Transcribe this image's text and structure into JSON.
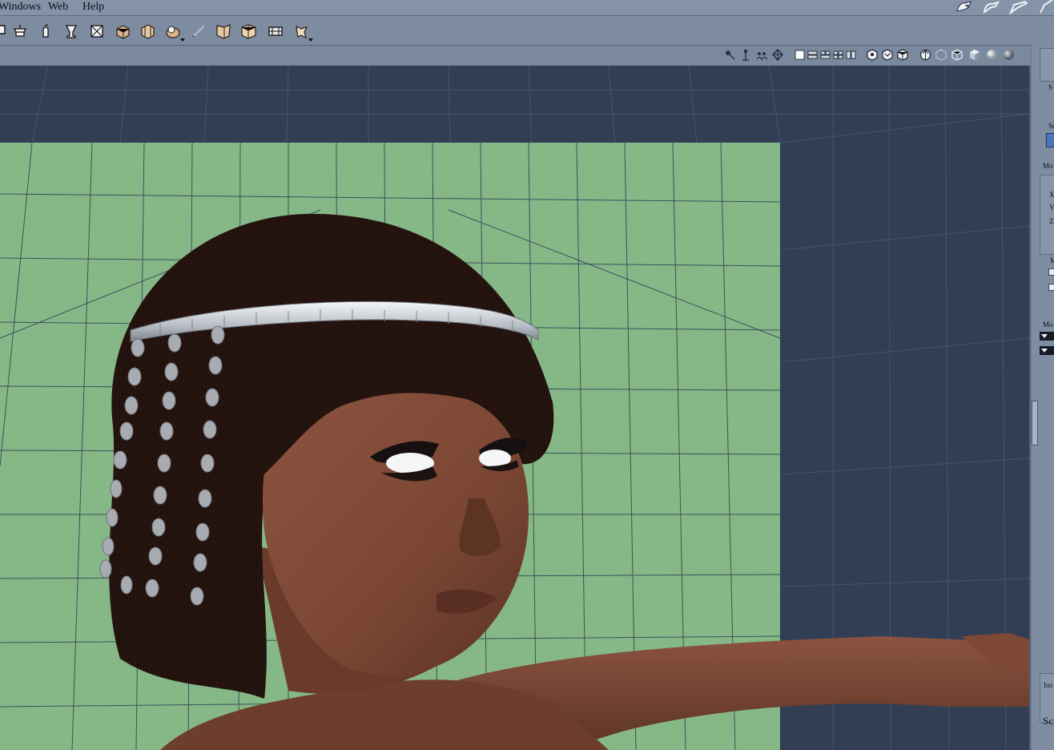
{
  "menu": {
    "items": [
      "Windows",
      "Web",
      "Help"
    ]
  },
  "toolbar": {
    "tools": [
      {
        "icon": "translate-icon"
      },
      {
        "icon": "scale-icon"
      },
      {
        "icon": "rotate-icon"
      },
      {
        "icon": "taper-icon"
      },
      {
        "icon": "frame-icon"
      },
      {
        "icon": "morph-box-icon"
      },
      {
        "icon": "group-box-icon"
      },
      {
        "icon": "view-magnifier-icon"
      },
      {
        "icon": "paint-brush-icon"
      },
      {
        "icon": "fold-icon"
      },
      {
        "icon": "fold-double-icon"
      },
      {
        "icon": "camera-dolly-icon"
      },
      {
        "icon": "twist-icon"
      }
    ]
  },
  "viewport": {
    "background_color": "#323e53",
    "backdrop_color": "#86b787",
    "grid_color": "#2f4058",
    "skin_color": "#7a4633",
    "hair_color": "#1b0e0a"
  },
  "right_panel": {
    "labels": [
      "S",
      "Sc",
      "Mo",
      "X",
      "Y",
      "Z",
      "M",
      "Mo",
      "Ins",
      "Sc"
    ]
  }
}
